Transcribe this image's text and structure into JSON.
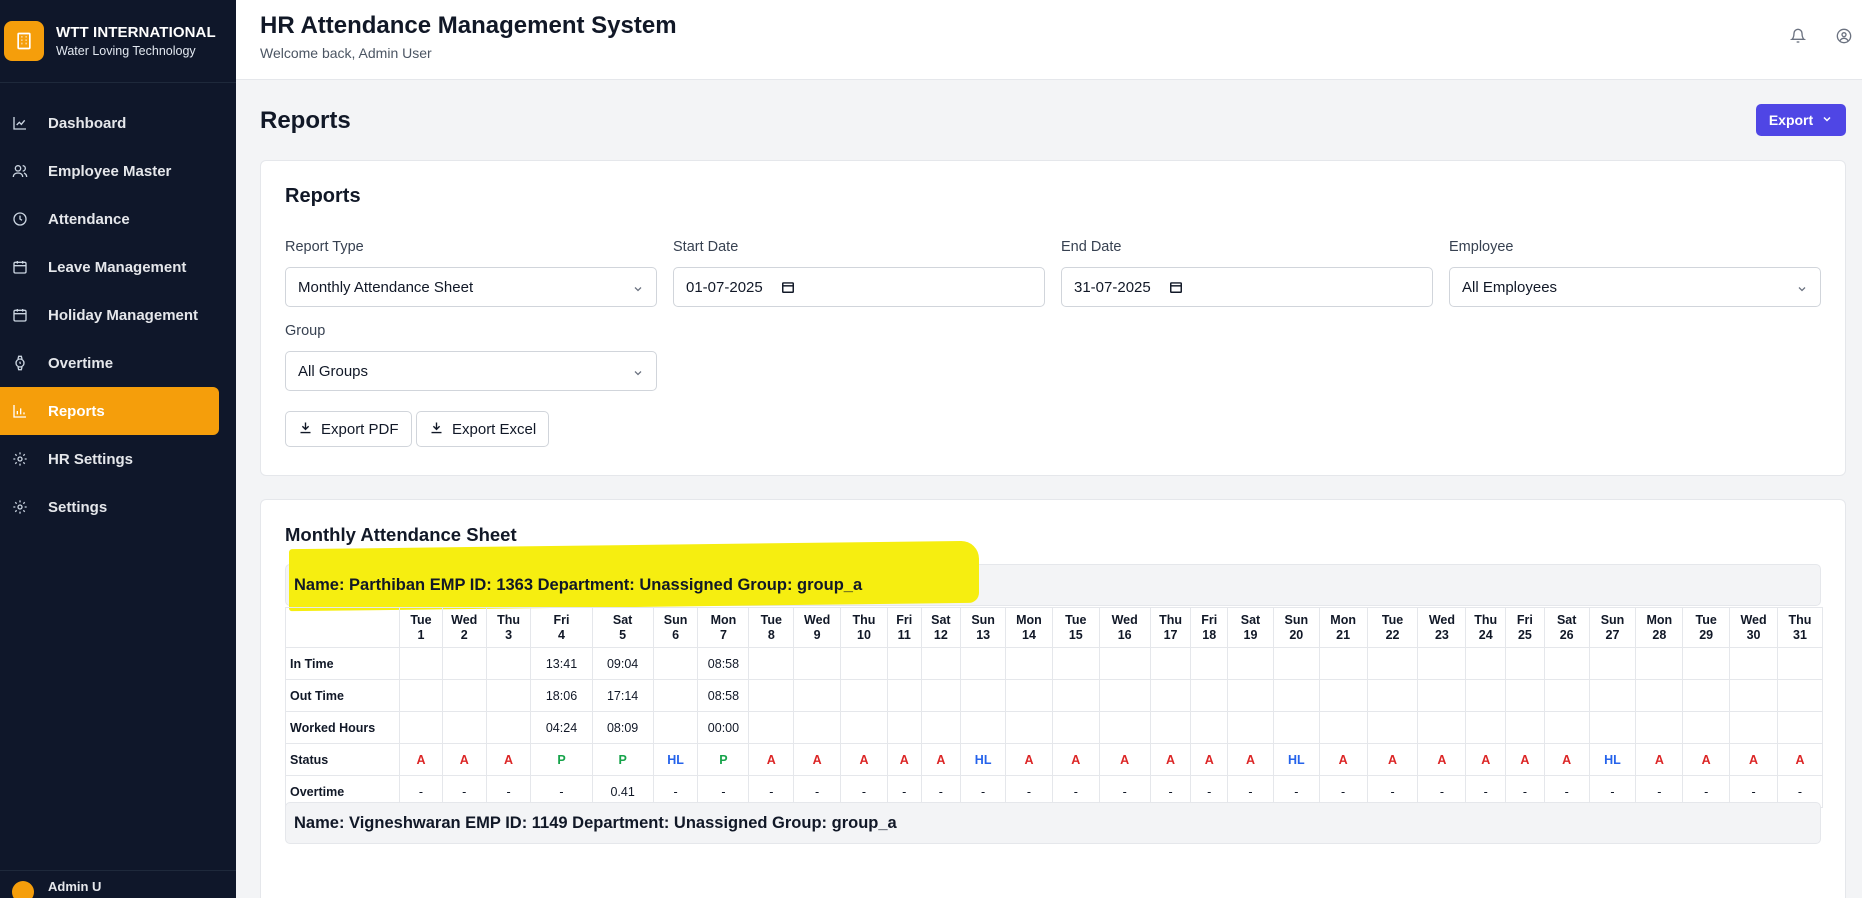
{
  "brand": {
    "name": "WTT INTERNATIONAL",
    "tagline": "Water Loving Technology"
  },
  "sidebar": {
    "items": [
      {
        "label": "Dashboard",
        "icon": "chart-line-icon"
      },
      {
        "label": "Employee Master",
        "icon": "users-icon"
      },
      {
        "label": "Attendance",
        "icon": "clock-icon"
      },
      {
        "label": "Leave Management",
        "icon": "calendar-icon"
      },
      {
        "label": "Holiday Management",
        "icon": "calendar-icon"
      },
      {
        "label": "Overtime",
        "icon": "watch-icon"
      },
      {
        "label": "Reports",
        "icon": "bar-chart-icon",
        "active": true
      },
      {
        "label": "HR Settings",
        "icon": "gear-icon"
      },
      {
        "label": "Settings",
        "icon": "gear-icon"
      }
    ],
    "footer_user": "Admin U"
  },
  "header": {
    "title": "HR Attendance Management System",
    "subtitle": "Welcome back, Admin User"
  },
  "page": {
    "title": "Reports",
    "export_label": "Export"
  },
  "filters": {
    "title": "Reports",
    "report_type": {
      "label": "Report Type",
      "value": "Monthly Attendance Sheet"
    },
    "start_date": {
      "label": "Start Date",
      "value": "01-07-2025"
    },
    "end_date": {
      "label": "End Date",
      "value": "31-07-2025"
    },
    "employee": {
      "label": "Employee",
      "value": "All Employees"
    },
    "group": {
      "label": "Group",
      "value": "All Groups"
    },
    "export_pdf": "Export PDF",
    "export_excel": "Export Excel"
  },
  "sheet": {
    "title": "Monthly Attendance Sheet",
    "employees": [
      {
        "banner": "Name: Parthiban EMP ID: 1363 Department: Unassigned Group: group_a",
        "days": [
          {
            "dow": "Tue",
            "d": "1",
            "in": "",
            "out": "",
            "worked": "",
            "status": "A",
            "ot": "-"
          },
          {
            "dow": "Wed",
            "d": "2",
            "in": "",
            "out": "",
            "worked": "",
            "status": "A",
            "ot": "-"
          },
          {
            "dow": "Thu",
            "d": "3",
            "in": "",
            "out": "",
            "worked": "",
            "status": "A",
            "ot": "-"
          },
          {
            "dow": "Fri",
            "d": "4",
            "in": "13:41",
            "out": "18:06",
            "worked": "04:24",
            "status": "P",
            "ot": "-"
          },
          {
            "dow": "Sat",
            "d": "5",
            "in": "09:04",
            "out": "17:14",
            "worked": "08:09",
            "status": "P",
            "ot": "0.41"
          },
          {
            "dow": "Sun",
            "d": "6",
            "in": "",
            "out": "",
            "worked": "",
            "status": "HL",
            "ot": "-"
          },
          {
            "dow": "Mon",
            "d": "7",
            "in": "08:58",
            "out": "08:58",
            "worked": "00:00",
            "status": "P",
            "ot": "-"
          },
          {
            "dow": "Tue",
            "d": "8",
            "in": "",
            "out": "",
            "worked": "",
            "status": "A",
            "ot": "-"
          },
          {
            "dow": "Wed",
            "d": "9",
            "in": "",
            "out": "",
            "worked": "",
            "status": "A",
            "ot": "-"
          },
          {
            "dow": "Thu",
            "d": "10",
            "in": "",
            "out": "",
            "worked": "",
            "status": "A",
            "ot": "-"
          },
          {
            "dow": "Fri",
            "d": "11",
            "in": "",
            "out": "",
            "worked": "",
            "status": "A",
            "ot": "-"
          },
          {
            "dow": "Sat",
            "d": "12",
            "in": "",
            "out": "",
            "worked": "",
            "status": "A",
            "ot": "-"
          },
          {
            "dow": "Sun",
            "d": "13",
            "in": "",
            "out": "",
            "worked": "",
            "status": "HL",
            "ot": "-"
          },
          {
            "dow": "Mon",
            "d": "14",
            "in": "",
            "out": "",
            "worked": "",
            "status": "A",
            "ot": "-"
          },
          {
            "dow": "Tue",
            "d": "15",
            "in": "",
            "out": "",
            "worked": "",
            "status": "A",
            "ot": "-"
          },
          {
            "dow": "Wed",
            "d": "16",
            "in": "",
            "out": "",
            "worked": "",
            "status": "A",
            "ot": "-"
          },
          {
            "dow": "Thu",
            "d": "17",
            "in": "",
            "out": "",
            "worked": "",
            "status": "A",
            "ot": "-"
          },
          {
            "dow": "Fri",
            "d": "18",
            "in": "",
            "out": "",
            "worked": "",
            "status": "A",
            "ot": "-"
          },
          {
            "dow": "Sat",
            "d": "19",
            "in": "",
            "out": "",
            "worked": "",
            "status": "A",
            "ot": "-"
          },
          {
            "dow": "Sun",
            "d": "20",
            "in": "",
            "out": "",
            "worked": "",
            "status": "HL",
            "ot": "-"
          },
          {
            "dow": "Mon",
            "d": "21",
            "in": "",
            "out": "",
            "worked": "",
            "status": "A",
            "ot": "-"
          },
          {
            "dow": "Tue",
            "d": "22",
            "in": "",
            "out": "",
            "worked": "",
            "status": "A",
            "ot": "-"
          },
          {
            "dow": "Wed",
            "d": "23",
            "in": "",
            "out": "",
            "worked": "",
            "status": "A",
            "ot": "-"
          },
          {
            "dow": "Thu",
            "d": "24",
            "in": "",
            "out": "",
            "worked": "",
            "status": "A",
            "ot": "-"
          },
          {
            "dow": "Fri",
            "d": "25",
            "in": "",
            "out": "",
            "worked": "",
            "status": "A",
            "ot": "-"
          },
          {
            "dow": "Sat",
            "d": "26",
            "in": "",
            "out": "",
            "worked": "",
            "status": "A",
            "ot": "-"
          },
          {
            "dow": "Sun",
            "d": "27",
            "in": "",
            "out": "",
            "worked": "",
            "status": "HL",
            "ot": "-"
          },
          {
            "dow": "Mon",
            "d": "28",
            "in": "",
            "out": "",
            "worked": "",
            "status": "A",
            "ot": "-"
          },
          {
            "dow": "Tue",
            "d": "29",
            "in": "",
            "out": "",
            "worked": "",
            "status": "A",
            "ot": "-"
          },
          {
            "dow": "Wed",
            "d": "30",
            "in": "",
            "out": "",
            "worked": "",
            "status": "A",
            "ot": "-"
          },
          {
            "dow": "Thu",
            "d": "31",
            "in": "",
            "out": "",
            "worked": "",
            "status": "A",
            "ot": "-"
          }
        ]
      },
      {
        "banner": "Name: Vigneshwaran EMP ID: 1149 Department: Unassigned Group: group_a"
      }
    ],
    "row_labels": {
      "in": "In Time",
      "out": "Out Time",
      "worked": "Worked Hours",
      "status": "Status",
      "ot": "Overtime"
    }
  },
  "colors": {
    "accent": "#f59e0b",
    "sidebar_bg": "#0f172a",
    "primary": "#4f46e5",
    "absent": "#dc2626",
    "present": "#16a34a",
    "holiday": "#2563eb",
    "highlight": "#f6ee10"
  }
}
